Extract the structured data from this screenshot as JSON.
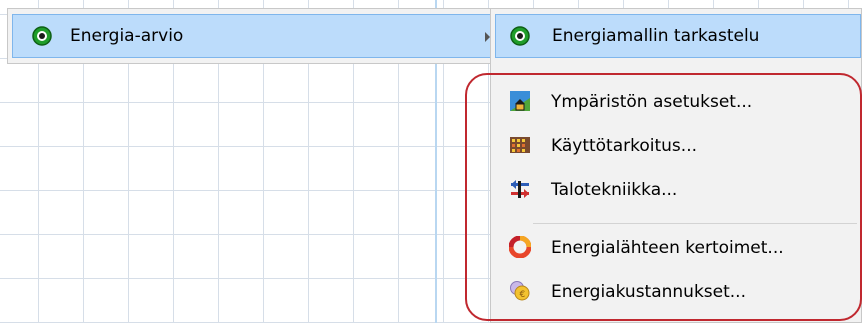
{
  "parent_menu": {
    "item_label": "Energia-arvio"
  },
  "submenu": {
    "items": [
      {
        "label": "Energiamallin tarkastelu",
        "icon": "green-circle-icon"
      },
      {
        "label": "Ympäristön asetukset...",
        "icon": "house-environment-icon"
      },
      {
        "label": "Käyttötarkoitus...",
        "icon": "building-grid-icon"
      },
      {
        "label": "Talotekniikka...",
        "icon": "hvac-arrows-icon"
      },
      {
        "label": "Energialähteen kertoimet...",
        "icon": "energy-source-ring-icon"
      },
      {
        "label": "Energiakustannukset...",
        "icon": "coins-icon"
      }
    ]
  },
  "colors": {
    "highlight": "#bcdcfb",
    "highlight_border": "#7fb6ec",
    "outline": "#c0282f"
  }
}
